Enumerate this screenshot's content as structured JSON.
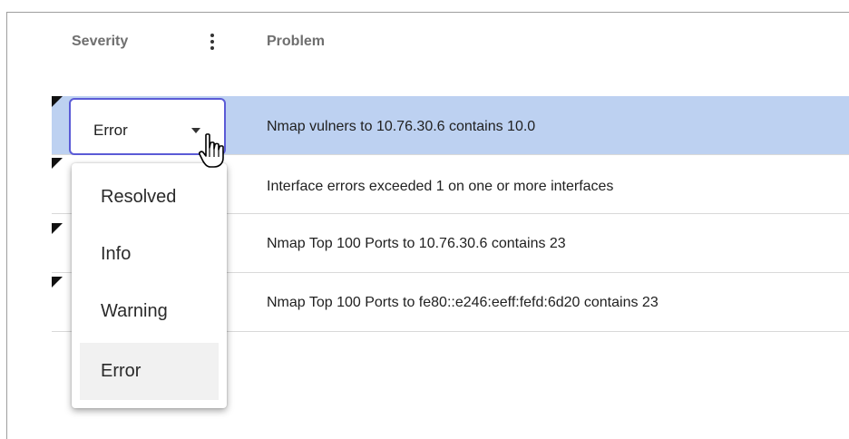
{
  "table": {
    "headers": {
      "severity": "Severity",
      "problem": "Problem"
    },
    "rows": [
      {
        "problem": "Nmap vulners to 10.76.30.6 contains 10.0",
        "selected": true
      },
      {
        "problem": "Interface errors exceeded 1 on one or more interfaces"
      },
      {
        "problem": "Nmap Top 100 Ports to 10.76.30.6 contains 23"
      },
      {
        "problem": "Nmap Top 100 Ports to fe80::e246:eeff:fefd:6d20 contains 23"
      }
    ]
  },
  "severity_select": {
    "value": "Error",
    "options": [
      "Resolved",
      "Info",
      "Warning",
      "Error"
    ],
    "highlighted": "Error"
  },
  "icons": {
    "column_menu": "more-vertical-icon",
    "dropdown": "caret-down-icon",
    "pointer": "hand-cursor-icon",
    "row_flag": "corner-flag-icon"
  },
  "colors": {
    "selected_row": "#bdd1f1",
    "focus_border": "#5b5bd6"
  }
}
